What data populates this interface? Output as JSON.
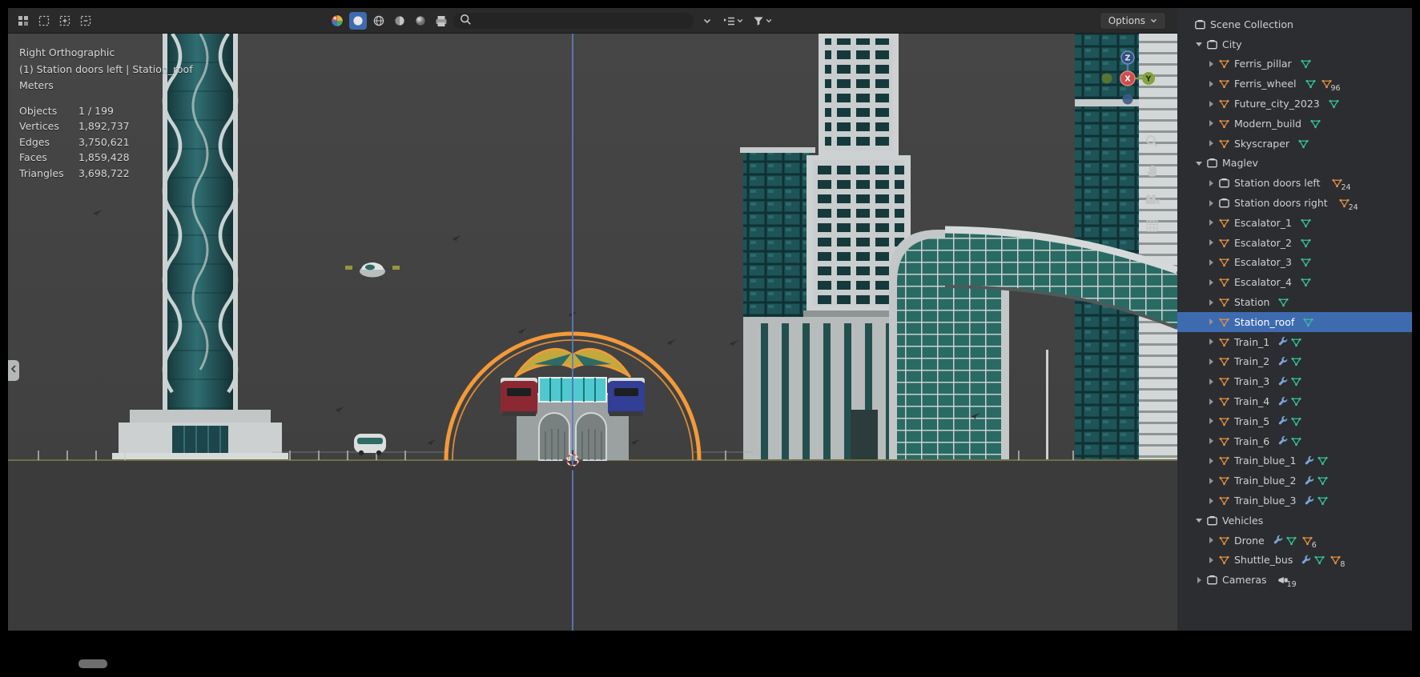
{
  "viewport": {
    "header": {
      "options_label": "Options",
      "search": {
        "value": "",
        "placeholder": ""
      }
    },
    "overlay": {
      "view_label": "Right Orthographic",
      "selection_label": "(1) Station doors left | Station_roof",
      "units_label": "Meters",
      "stats": [
        {
          "label": "Objects",
          "value": "1 / 199"
        },
        {
          "label": "Vertices",
          "value": "1,892,737"
        },
        {
          "label": "Edges",
          "value": "3,750,621"
        },
        {
          "label": "Faces",
          "value": "1,859,428"
        },
        {
          "label": "Triangles",
          "value": "3,698,722"
        }
      ]
    },
    "gizmo": {
      "x": "X",
      "y": "Y",
      "z": "Z"
    }
  },
  "outliner": {
    "rows": [
      {
        "label": "Scene Collection",
        "depth": 0,
        "disc": "none",
        "icon": "collection"
      },
      {
        "label": "City",
        "depth": 1,
        "disc": "open",
        "icon": "collection"
      },
      {
        "label": "Ferris_pillar",
        "depth": 2,
        "disc": "closed",
        "icon": "mesh",
        "data": true
      },
      {
        "label": "Ferris_wheel",
        "depth": 2,
        "disc": "closed",
        "icon": "mesh",
        "data": true,
        "count": "96",
        "count_icon": "mesh"
      },
      {
        "label": "Future_city_2023",
        "depth": 2,
        "disc": "closed",
        "icon": "mesh",
        "data": true
      },
      {
        "label": "Modern_build",
        "depth": 2,
        "disc": "closed",
        "icon": "mesh",
        "data": true
      },
      {
        "label": "Skyscraper",
        "depth": 2,
        "disc": "closed",
        "icon": "mesh",
        "data": true
      },
      {
        "label": "Maglev",
        "depth": 1,
        "disc": "open",
        "icon": "collection"
      },
      {
        "label": "Station doors left",
        "depth": 2,
        "disc": "closed",
        "icon": "collection",
        "count": "24",
        "count_icon": "mesh"
      },
      {
        "label": "Station doors right",
        "depth": 2,
        "disc": "closed",
        "icon": "collection",
        "count": "24",
        "count_icon": "mesh"
      },
      {
        "label": "Escalator_1",
        "depth": 2,
        "disc": "closed",
        "icon": "mesh",
        "data": true
      },
      {
        "label": "Escalator_2",
        "depth": 2,
        "disc": "closed",
        "icon": "mesh",
        "data": true
      },
      {
        "label": "Escalator_3",
        "depth": 2,
        "disc": "closed",
        "icon": "mesh",
        "data": true
      },
      {
        "label": "Escalator_4",
        "depth": 2,
        "disc": "closed",
        "icon": "mesh",
        "data": true
      },
      {
        "label": "Station",
        "depth": 2,
        "disc": "closed",
        "icon": "mesh",
        "data": true
      },
      {
        "label": "Station_roof",
        "depth": 2,
        "disc": "closed",
        "icon": "mesh",
        "data": true,
        "selected": true
      },
      {
        "label": "Train_1",
        "depth": 2,
        "disc": "closed",
        "icon": "mesh",
        "mod": true,
        "data": true
      },
      {
        "label": "Train_2",
        "depth": 2,
        "disc": "closed",
        "icon": "mesh",
        "mod": true,
        "data": true
      },
      {
        "label": "Train_3",
        "depth": 2,
        "disc": "closed",
        "icon": "mesh",
        "mod": true,
        "data": true
      },
      {
        "label": "Train_4",
        "depth": 2,
        "disc": "closed",
        "icon": "mesh",
        "mod": true,
        "data": true
      },
      {
        "label": "Train_5",
        "depth": 2,
        "disc": "closed",
        "icon": "mesh",
        "mod": true,
        "data": true
      },
      {
        "label": "Train_6",
        "depth": 2,
        "disc": "closed",
        "icon": "mesh",
        "mod": true,
        "data": true
      },
      {
        "label": "Train_blue_1",
        "depth": 2,
        "disc": "closed",
        "icon": "mesh",
        "mod": true,
        "data": true
      },
      {
        "label": "Train_blue_2",
        "depth": 2,
        "disc": "closed",
        "icon": "mesh",
        "mod": true,
        "data": true
      },
      {
        "label": "Train_blue_3",
        "depth": 2,
        "disc": "closed",
        "icon": "mesh",
        "mod": true,
        "data": true
      },
      {
        "label": "Vehicles",
        "depth": 1,
        "disc": "open",
        "icon": "collection"
      },
      {
        "label": "Drone",
        "depth": 2,
        "disc": "closed",
        "icon": "mesh",
        "mod": true,
        "data": true,
        "count": "6",
        "count_icon": "mesh"
      },
      {
        "label": "Shuttle_bus",
        "depth": 2,
        "disc": "closed",
        "icon": "mesh",
        "mod": true,
        "data": true,
        "count": "8",
        "count_icon": "mesh"
      },
      {
        "label": "Cameras",
        "depth": 1,
        "disc": "closed",
        "icon": "collection",
        "count": "19",
        "count_icon": "camera"
      }
    ]
  },
  "colors": {
    "viewport_bg": "#424242",
    "header_bg": "#2a2a2a",
    "outliner_bg": "#2b2d31",
    "selected_blue": "#3e6bb0",
    "selection_orange": "#f49a38",
    "axis_y_olive": "#6f7045",
    "axis_z_blue": "#5a7fc0",
    "object_orange": "#dd8d3f",
    "data_green": "#37be92",
    "modifier_blue": "#7aa6da",
    "icon_gray": "#c6c6c6",
    "text_light": "#d8d8d8"
  }
}
